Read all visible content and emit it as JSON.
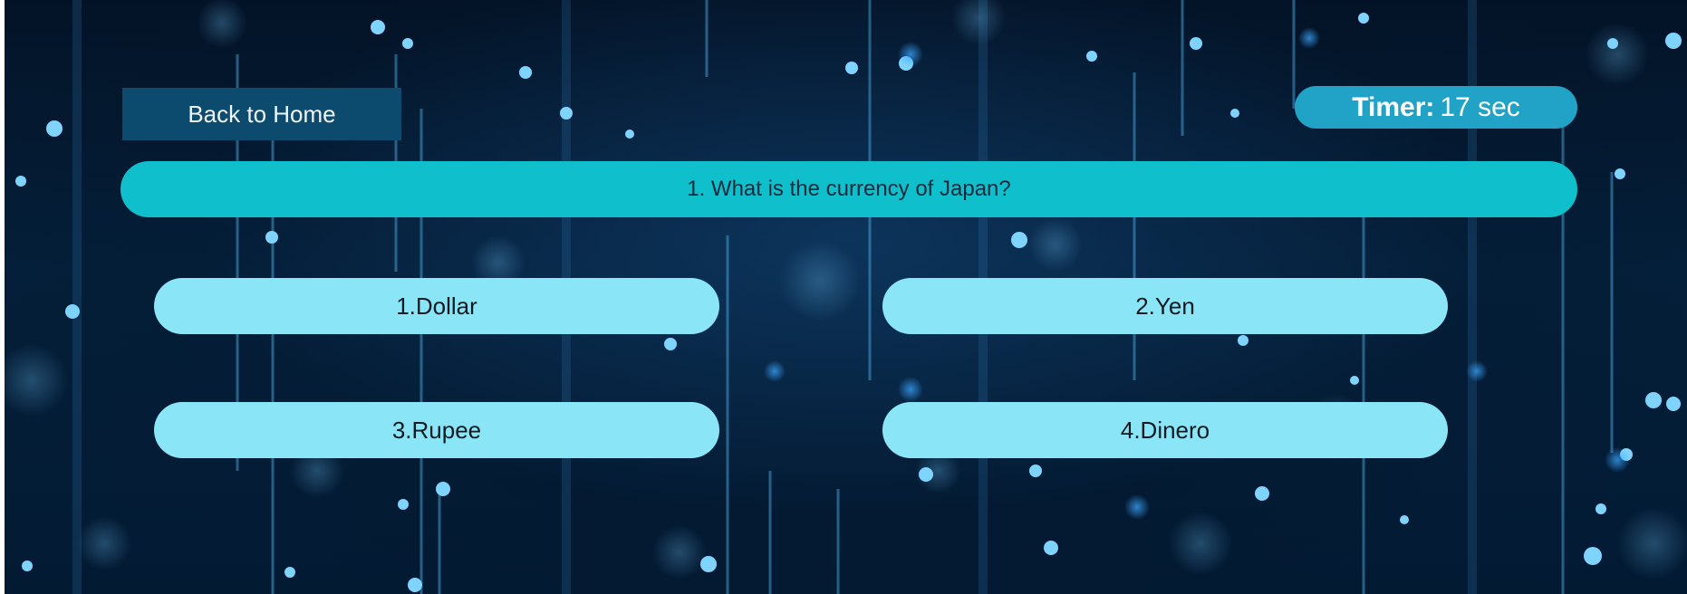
{
  "nav": {
    "back_label": "Back to Home"
  },
  "timer": {
    "label": "Timer:",
    "value": "17 sec"
  },
  "question": {
    "text": "1. What is the currency of Japan?"
  },
  "options": [
    {
      "label": "1.Dollar"
    },
    {
      "label": "2.Yen"
    },
    {
      "label": "3.Rupee"
    },
    {
      "label": "4.Dinero"
    }
  ],
  "colors": {
    "background": "#031a33",
    "back_button": "#0c4a6e",
    "timer_pill": "#20a3c7",
    "question_bar": "#0fc0cc",
    "option_button": "#8ae6f6"
  }
}
